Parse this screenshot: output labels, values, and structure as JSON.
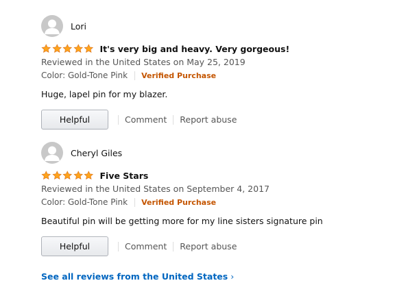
{
  "reviews": [
    {
      "profile_name": "Lori",
      "rating": 5,
      "title": "It's very big and heavy. Very gorgeous!",
      "date_line": "Reviewed in the United States on May 25, 2019",
      "format": "Color: Gold-Tone Pink",
      "verified": "Verified Purchase",
      "body": "Huge, lapel pin for my blazer.",
      "helpful_label": "Helpful",
      "comment_label": "Comment",
      "report_label": "Report abuse"
    },
    {
      "profile_name": "Cheryl Giles",
      "rating": 5,
      "title": "Five Stars",
      "date_line": "Reviewed in the United States on September 4, 2017",
      "format": "Color: Gold-Tone Pink",
      "verified": "Verified Purchase",
      "body": "Beautiful pin will be getting more for my line sisters signature pin",
      "helpful_label": "Helpful",
      "comment_label": "Comment",
      "report_label": "Report abuse"
    }
  ],
  "see_all": {
    "label": "See all reviews from the United States",
    "chevron": "›"
  },
  "colors": {
    "star": "#ffa41c",
    "star_outline": "#de7921",
    "verified": "#c45500",
    "link": "#0066c0",
    "meta": "#555555"
  },
  "icons": {
    "avatar": "default-avatar-icon",
    "star": "star-icon"
  }
}
